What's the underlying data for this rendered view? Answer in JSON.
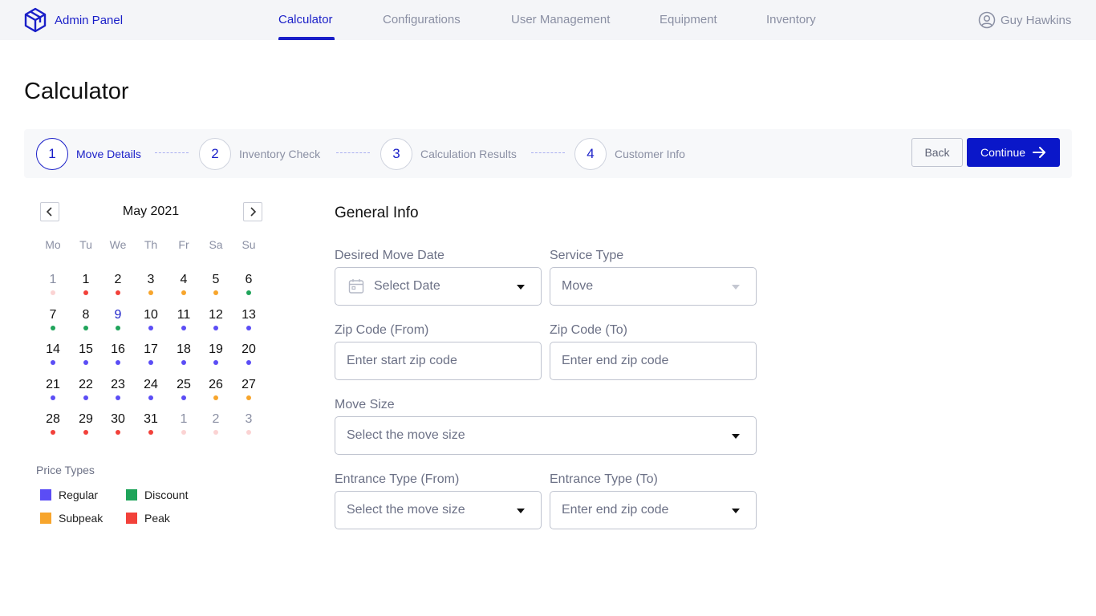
{
  "brand": {
    "name": "Admin Panel"
  },
  "nav": {
    "items": [
      {
        "label": "Calculator",
        "active": true
      },
      {
        "label": "Configurations",
        "active": false
      },
      {
        "label": "User Management",
        "active": false
      },
      {
        "label": "Equipment",
        "active": false
      },
      {
        "label": "Inventory",
        "active": false
      }
    ]
  },
  "user": {
    "name": "Guy Hawkins"
  },
  "page": {
    "title": "Calculator"
  },
  "stepper": {
    "steps": [
      {
        "number": "1",
        "label": "Move Details",
        "active": true
      },
      {
        "number": "2",
        "label": "Inventory Check",
        "active": false
      },
      {
        "number": "3",
        "label": "Calculation Results",
        "active": false
      },
      {
        "number": "4",
        "label": "Customer Info",
        "active": false
      }
    ],
    "back_label": "Back",
    "continue_label": "Continue"
  },
  "calendar": {
    "month": "May 2021",
    "weekdays": [
      "Mo",
      "Tu",
      "We",
      "Th",
      "Fr",
      "Sa",
      "Su"
    ],
    "weeks": [
      [
        {
          "day": "1",
          "type": "peak",
          "muted": true
        },
        {
          "day": "1",
          "type": "peak"
        },
        {
          "day": "2",
          "type": "peak"
        },
        {
          "day": "3",
          "type": "subpeak"
        },
        {
          "day": "4",
          "type": "subpeak"
        },
        {
          "day": "5",
          "type": "subpeak"
        },
        {
          "day": "6",
          "type": "discount"
        }
      ],
      [
        {
          "day": "7",
          "type": "discount"
        },
        {
          "day": "8",
          "type": "discount"
        },
        {
          "day": "9",
          "type": "discount",
          "today": true
        },
        {
          "day": "10",
          "type": "regular"
        },
        {
          "day": "11",
          "type": "regular"
        },
        {
          "day": "12",
          "type": "regular"
        },
        {
          "day": "13",
          "type": "regular"
        }
      ],
      [
        {
          "day": "14",
          "type": "regular"
        },
        {
          "day": "15",
          "type": "regular"
        },
        {
          "day": "16",
          "type": "regular"
        },
        {
          "day": "17",
          "type": "regular"
        },
        {
          "day": "18",
          "type": "regular"
        },
        {
          "day": "19",
          "type": "regular"
        },
        {
          "day": "20",
          "type": "regular"
        }
      ],
      [
        {
          "day": "21",
          "type": "regular"
        },
        {
          "day": "22",
          "type": "regular"
        },
        {
          "day": "23",
          "type": "regular"
        },
        {
          "day": "24",
          "type": "regular"
        },
        {
          "day": "25",
          "type": "regular"
        },
        {
          "day": "26",
          "type": "subpeak"
        },
        {
          "day": "27",
          "type": "subpeak"
        }
      ],
      [
        {
          "day": "28",
          "type": "peak"
        },
        {
          "day": "29",
          "type": "peak"
        },
        {
          "day": "30",
          "type": "peak"
        },
        {
          "day": "31",
          "type": "peak"
        },
        {
          "day": "1",
          "type": "peak",
          "muted": true
        },
        {
          "day": "2",
          "type": "peak",
          "muted": true
        },
        {
          "day": "3",
          "type": "peak",
          "muted": true
        }
      ]
    ],
    "colors": {
      "regular": "#5b4df5",
      "discount": "#1fa45a",
      "subpeak": "#f7a52c",
      "peak": "#f2413a",
      "muted_peak": "#fbd3d3"
    }
  },
  "legend": {
    "title": "Price Types",
    "items": [
      {
        "label": "Regular",
        "color": "#5b4df5"
      },
      {
        "label": "Discount",
        "color": "#1fa45a"
      },
      {
        "label": "Subpeak",
        "color": "#f7a52c"
      },
      {
        "label": "Peak",
        "color": "#f2413a"
      }
    ]
  },
  "form": {
    "title": "General Info",
    "move_date": {
      "label": "Desired Move Date",
      "value": "Select Date"
    },
    "service_type": {
      "label": "Service Type",
      "value": "Move"
    },
    "zip_from": {
      "label": "Zip Code (From)",
      "placeholder": "Enter start zip code"
    },
    "zip_to": {
      "label": "Zip Code (To)",
      "placeholder": "Enter end zip code"
    },
    "move_size": {
      "label": "Move Size",
      "value": "Select the move size"
    },
    "entrance_from": {
      "label": "Entrance Type (From)",
      "value": "Select the move size"
    },
    "entrance_to": {
      "label": "Entrance Type (To)",
      "value": "Enter end zip code"
    }
  }
}
